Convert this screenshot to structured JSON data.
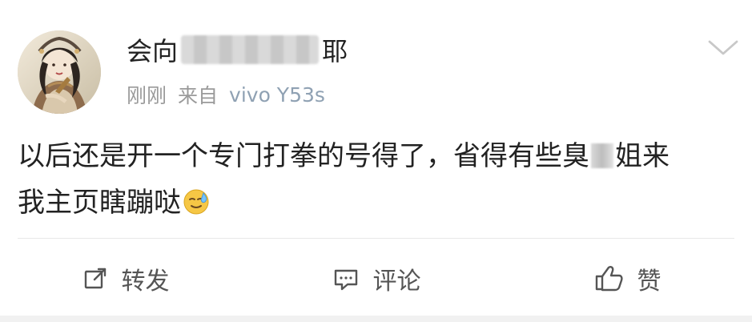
{
  "post": {
    "username": {
      "prefix": "会向",
      "suffix": "耶"
    },
    "meta": {
      "time": "刚刚",
      "source_prefix": "来自",
      "device": "vivo Y53s"
    },
    "content": {
      "line1_before_blur": "以后还是开一个专门打拳的号得了，省得有些臭",
      "line1_after_blur": "姐来",
      "line2": "我主页瞎蹦哒"
    },
    "actions": {
      "repost": "转发",
      "comment": "评论",
      "like": "赞"
    },
    "icons": {
      "avatar": "avatar-illustration",
      "menu": "chevron-down-icon",
      "repost": "repost-icon",
      "comment": "comment-icon",
      "like": "thumbs-up-icon",
      "emoji": "sweat-smile-emoji"
    },
    "colors": {
      "text_primary": "#222222",
      "text_secondary": "#9a9a9a",
      "device_text": "#8fa1b3",
      "divider": "#e8e8e8"
    }
  }
}
